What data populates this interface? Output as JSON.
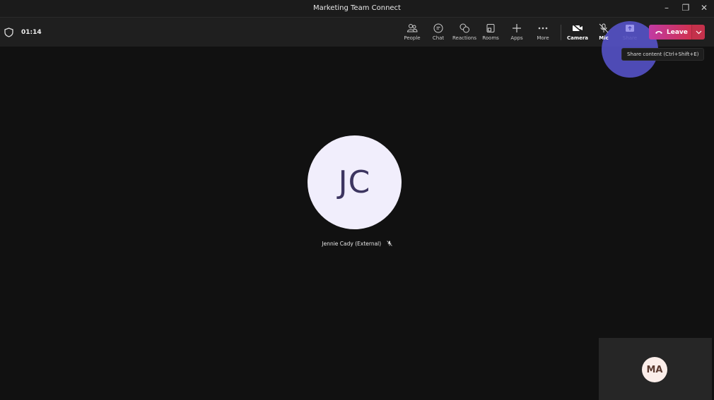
{
  "window": {
    "title": "Marketing Team Connect"
  },
  "meeting": {
    "timer": "01:14"
  },
  "toolbar": {
    "people": "People",
    "chat": "Chat",
    "reactions": "Reactions",
    "rooms": "Rooms",
    "apps": "Apps",
    "more": "More",
    "camera": "Camera",
    "mic": "Mic",
    "share": "Share",
    "leave": "Leave"
  },
  "tooltip": "Share content (Ctrl+Shift+E)",
  "participant": {
    "initials": "JC",
    "name": "Jennie Cady (External)"
  },
  "self": {
    "initials": "MA"
  },
  "colors": {
    "leave": "#c4314b",
    "highlight": "#5552c8",
    "avatar_bg": "#f1eefc"
  }
}
